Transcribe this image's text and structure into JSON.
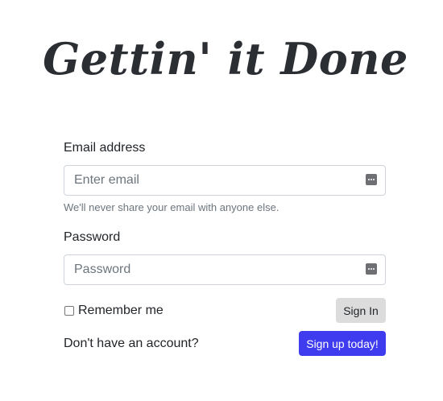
{
  "app": {
    "logo_text": "Gettin' it Done"
  },
  "form": {
    "email": {
      "label": "Email address",
      "placeholder": "Enter email",
      "value": "",
      "help_text": "We'll never share your email with anyone else."
    },
    "password": {
      "label": "Password",
      "placeholder": "Password",
      "value": ""
    },
    "remember_label": "Remember me",
    "remember_checked": false,
    "signin_label": "Sign In"
  },
  "signup": {
    "prompt": "Don't have an account?",
    "button_label": "Sign up today!"
  },
  "colors": {
    "primary_button": "#3f3cf0",
    "secondary_button": "#dcdcdc",
    "text": "#212529",
    "muted": "#6c757d"
  },
  "icons": {
    "field_icon": "password-manager-icon"
  }
}
